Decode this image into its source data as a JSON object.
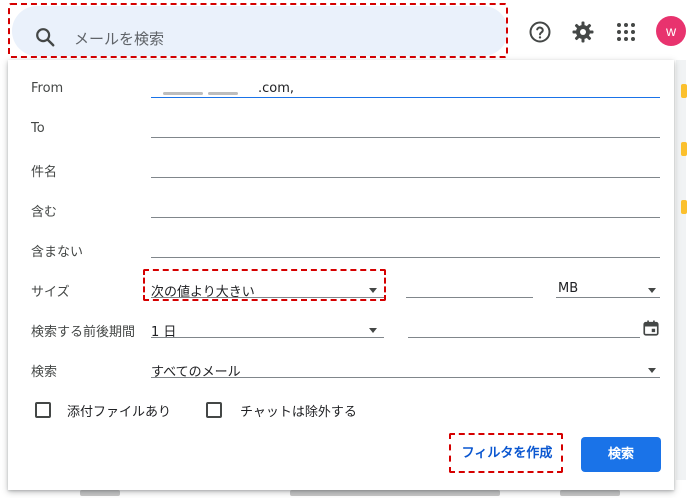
{
  "search": {
    "placeholder": "メールを検索"
  },
  "account": {
    "avatar_letter": "w",
    "avatar_color": "#e8336e"
  },
  "icons": {
    "help": "help-circle-icon",
    "settings": "gear-icon",
    "apps": "apps-grid-icon",
    "search": "search-icon",
    "calendar": "calendar-icon"
  },
  "form": {
    "from_label": "From",
    "from_value": ".com,",
    "to_label": "To",
    "subject_label": "件名",
    "includes_label": "含む",
    "excludes_label": "含まない",
    "size_label": "サイズ",
    "size_operator": "次の値より大きい",
    "size_unit": "MB",
    "date_label": "検索する前後期間",
    "date_range": "1 日",
    "search_in_label": "検索",
    "search_in_value": "すべてのメール",
    "attachment_label": "添付ファイルあり",
    "exclude_chats_label": "チャットは除外する",
    "create_filter_label": "フィルタを作成",
    "search_button_label": "検索"
  },
  "colors": {
    "accent": "#1a73e8",
    "search_bg": "#eaf1fb",
    "annotation": "#d50000"
  }
}
